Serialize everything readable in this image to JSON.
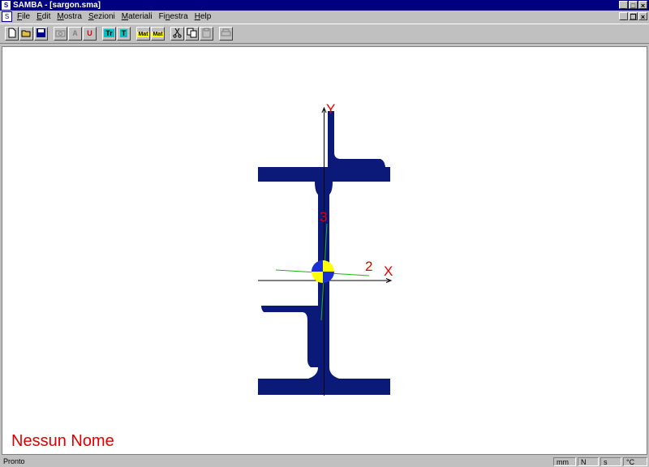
{
  "window": {
    "title": "SAMBA - [sargon.sma]"
  },
  "menu": [
    {
      "pre": "",
      "u": "F",
      "post": "ile"
    },
    {
      "pre": "",
      "u": "E",
      "post": "dit"
    },
    {
      "pre": "",
      "u": "M",
      "post": "ostra"
    },
    {
      "pre": "",
      "u": "S",
      "post": "ezioni"
    },
    {
      "pre": "",
      "u": "M",
      "post": "ateriali"
    },
    {
      "pre": "Fi",
      "u": "n",
      "post": "estra"
    },
    {
      "pre": "",
      "u": "H",
      "post": "elp"
    }
  ],
  "toolbar": {
    "font_label": "A",
    "u_label": "U",
    "tr_label": "Tr",
    "t_label": "T",
    "mat_label": "Mat"
  },
  "canvas": {
    "axis_y": "Y",
    "axis_x": "X",
    "principal_3": "3",
    "principal_2": "2",
    "section_name": "Nessun Nome"
  },
  "status": {
    "left": "Pronto",
    "units": [
      "mm",
      "N",
      "s",
      "°C"
    ]
  },
  "colors": {
    "section": "#0b1a78",
    "axis_label": "#e00000",
    "principal_axis": "#20b020"
  }
}
